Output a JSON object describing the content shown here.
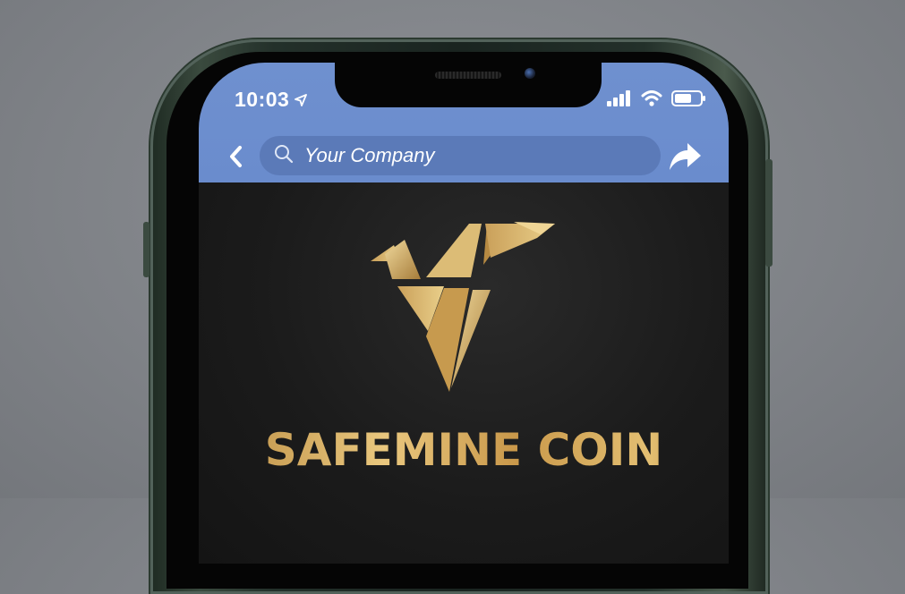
{
  "status_bar": {
    "time": "10:03",
    "location_icon": "location-arrow-icon",
    "signal_icon": "cellular-signal-icon",
    "wifi_icon": "wifi-icon",
    "battery_icon": "battery-icon"
  },
  "navigation": {
    "back_icon": "chevron-left-icon",
    "search_icon": "search-icon",
    "search_value": "Your Company",
    "share_icon": "share-arrow-icon"
  },
  "content": {
    "logo_icon": "origami-bird-icon",
    "brand_name": "SAFEMINE COIN"
  },
  "colors": {
    "header_blue": "#6a8ccd",
    "search_pill": "#5b7ab8",
    "gold": "#d4ab5e",
    "screen_bg": "#1b1b1b"
  }
}
